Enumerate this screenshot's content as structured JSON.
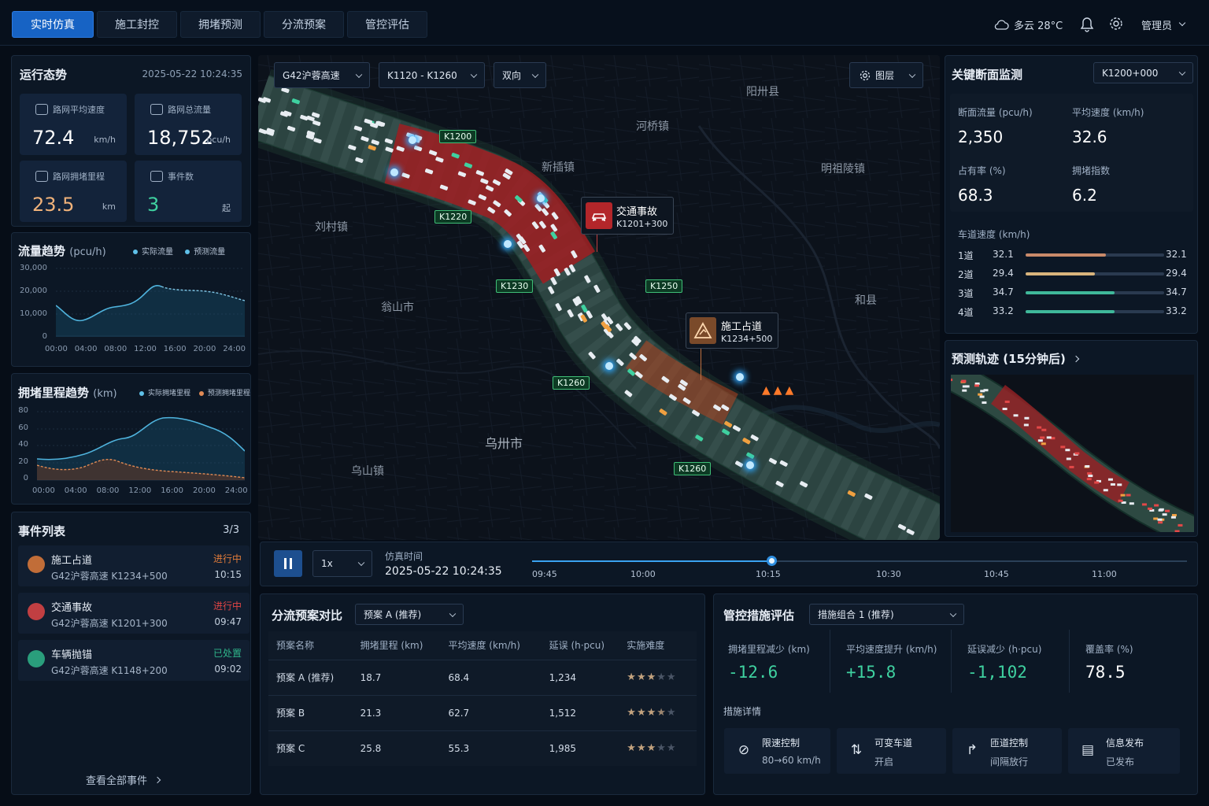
{
  "nav": {
    "tabs": [
      "实时仿真",
      "施工封控",
      "拥堵预测",
      "分流预案",
      "管控评估"
    ],
    "active_tab": 0,
    "weather": "多云 28°C",
    "user": "管理员"
  },
  "status": {
    "title": "运行态势",
    "datetime": "2025-05-22 10:24:35",
    "kpis": [
      {
        "label": "路网平均速度",
        "value": "72.4",
        "unit": "km/h",
        "icon": "speed-icon",
        "color": "#ffffff"
      },
      {
        "label": "路网总流量",
        "value": "18,752",
        "unit": "pcu/h",
        "icon": "flow-icon",
        "color": "#ffffff"
      },
      {
        "label": "路网拥堵里程",
        "value": "23.5",
        "unit": "km",
        "icon": "gauge-icon",
        "color": "#f0b27a"
      },
      {
        "label": "事件数",
        "value": "3",
        "unit": "起",
        "icon": "event-icon",
        "color": "#3fd1a0"
      }
    ]
  },
  "flow_trend": {
    "title": "流量趋势",
    "unit": "(pcu/h)",
    "legend": [
      "实际流量",
      "预测流量"
    ],
    "ylabels": [
      "30,000",
      "20,000",
      "10,000",
      "0"
    ],
    "xlabels": [
      "00:00",
      "04:00",
      "08:00",
      "12:00",
      "16:00",
      "20:00",
      "24:00"
    ]
  },
  "jam_trend": {
    "title": "拥堵里程趋势",
    "unit": "(km)",
    "legend": [
      "实际拥堵里程",
      "预测拥堵里程"
    ],
    "ylabels": [
      "80",
      "60",
      "40",
      "20",
      "0"
    ],
    "xlabels": [
      "00:00",
      "04:00",
      "08:00",
      "12:00",
      "16:00",
      "20:00",
      "24:00"
    ]
  },
  "events": {
    "title": "事件列表",
    "count": "3/3",
    "items": [
      {
        "name": "施工占道",
        "loc": "G42沪蓉高速 K1234+500",
        "status": "进行中",
        "time": "10:15",
        "color": "#e07b3a",
        "icon": "construction-icon"
      },
      {
        "name": "交通事故",
        "loc": "G42沪蓉高速 K1201+300",
        "status": "进行中",
        "time": "09:47",
        "color": "#e04545",
        "icon": "accident-icon"
      },
      {
        "name": "车辆抛锚",
        "loc": "G42沪蓉高速 K1148+200",
        "status": "已处置",
        "time": "09:02",
        "color": "#2fb58a",
        "icon": "breakdown-icon"
      }
    ],
    "view_all": "查看全部事件"
  },
  "map": {
    "road_select": "G42沪蓉高速",
    "range_select": "K1120 - K1260",
    "dir_select": "双向",
    "layers": "图层",
    "places": [
      "阳卅县",
      "河桥镇",
      "新插镇",
      "明祖陵镇",
      "刘村镇",
      "翁山市",
      "和县",
      "乌卅市",
      "乌山镇"
    ],
    "signs": [
      "K1200",
      "K1220",
      "K1230",
      "K1250",
      "K1260",
      "K1260"
    ],
    "accident": {
      "title": "交通事故",
      "km": "K1201+300"
    },
    "construction": {
      "title": "施工占道",
      "km": "K1234+500"
    }
  },
  "playback": {
    "speed": "1x",
    "label": "仿真时间",
    "time": "2025-05-22 10:24:35",
    "ticks": [
      "09:45",
      "10:00",
      "10:15",
      "10:30",
      "10:45",
      "11:00"
    ],
    "progress": 0.365
  },
  "section": {
    "title": "关键断面监测",
    "select": "K1200+000",
    "metrics": [
      {
        "label": "断面流量 (pcu/h)",
        "value": "2,350"
      },
      {
        "label": "平均速度 (km/h)",
        "value": "32.6"
      },
      {
        "label": "占有率 (%)",
        "value": "68.3"
      },
      {
        "label": "拥堵指数",
        "value": "6.2"
      }
    ],
    "lane_title": "车道速度 (km/h)",
    "lanes": [
      {
        "name": "1道",
        "v": "32.1",
        "frac": 0.58,
        "color": "#c98a6a"
      },
      {
        "name": "2道",
        "v": "29.4",
        "frac": 0.5,
        "color": "#d8b47c"
      },
      {
        "name": "3道",
        "v": "34.7",
        "frac": 0.64,
        "color": "#3fb89a"
      },
      {
        "name": "4道",
        "v": "33.2",
        "frac": 0.64,
        "color": "#3fb89a"
      }
    ]
  },
  "forecast": {
    "title": "预测轨迹 (15分钟后)"
  },
  "plans": {
    "title": "分流预案对比",
    "select": "预案 A (推荐)",
    "headers": [
      "预案名称",
      "拥堵里程 (km)",
      "平均速度 (km/h)",
      "延误 (h·pcu)",
      "实施难度"
    ],
    "rows": [
      {
        "name": "预案 A (推荐)",
        "jam": "18.7",
        "speed": "68.4",
        "delay": "1,234",
        "stars": 3
      },
      {
        "name": "预案 B",
        "jam": "21.3",
        "speed": "62.7",
        "delay": "1,512",
        "stars": 3.5
      },
      {
        "name": "预案 C",
        "jam": "25.8",
        "speed": "55.3",
        "delay": "1,985",
        "stars": 3
      }
    ]
  },
  "evaluation": {
    "title": "管控措施评估",
    "select": "措施组合 1 (推荐)",
    "metrics": [
      {
        "label": "拥堵里程减少 (km)",
        "value": "-12.6",
        "color": "#3fd1a0"
      },
      {
        "label": "平均速度提升 (km/h)",
        "value": "+15.8",
        "color": "#3fd1a0"
      },
      {
        "label": "延误减少 (h·pcu)",
        "value": "-1,102",
        "color": "#3fd1a0"
      },
      {
        "label": "覆盖率 (%)",
        "value": "78.5",
        "color": "#ffffff"
      }
    ],
    "detail_title": "措施详情",
    "measures": [
      {
        "name": "限速控制",
        "detail": "80→60 km/h",
        "icon": "speed-limit-icon"
      },
      {
        "name": "可变车道",
        "detail": "开启",
        "icon": "lane-icon"
      },
      {
        "name": "匝道控制",
        "detail": "间隔放行",
        "icon": "ramp-icon"
      },
      {
        "name": "信息发布",
        "detail": "已发布",
        "icon": "message-icon"
      }
    ]
  }
}
